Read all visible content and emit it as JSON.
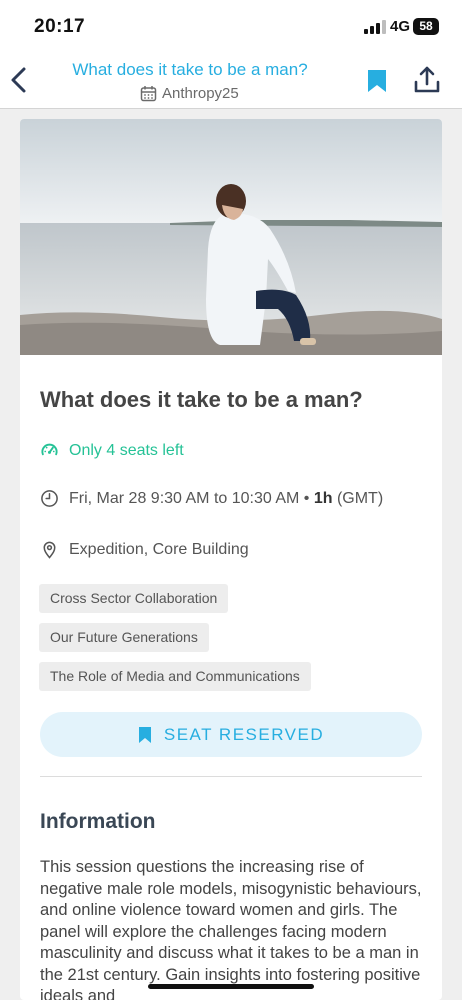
{
  "status_bar": {
    "time": "20:17",
    "network": "4G",
    "battery": "58"
  },
  "header": {
    "title": "What does it take to be a man?",
    "event_name": "Anthropy25",
    "icons": [
      "chevron-left-icon",
      "calendar-icon",
      "bookmark-icon",
      "share-icon"
    ]
  },
  "session": {
    "title": "What does it take to be a man?",
    "seats_left": "Only 4 seats left",
    "time_text": "Fri, Mar 28 9:30 AM to 10:30 AM •",
    "duration": "1h",
    "timezone": "(GMT)",
    "location": "Expedition, Core Building",
    "tags": [
      "Cross Sector Collaboration",
      "Our Future Generations",
      "The Role of Media and Communications"
    ],
    "reserve_label": "SEAT RESERVED"
  },
  "information": {
    "heading": "Information",
    "body": "This session questions the increasing rise of negative male role models, misogynistic behaviours, and online violence toward women and girls. The panel will explore the challenges facing modern masculinity and discuss what it takes to be a man in the 21st century. Gain insights into fostering positive ideals and"
  },
  "colors": {
    "accent": "#27aee0",
    "seats": "#25c296",
    "background": "#efefef"
  }
}
